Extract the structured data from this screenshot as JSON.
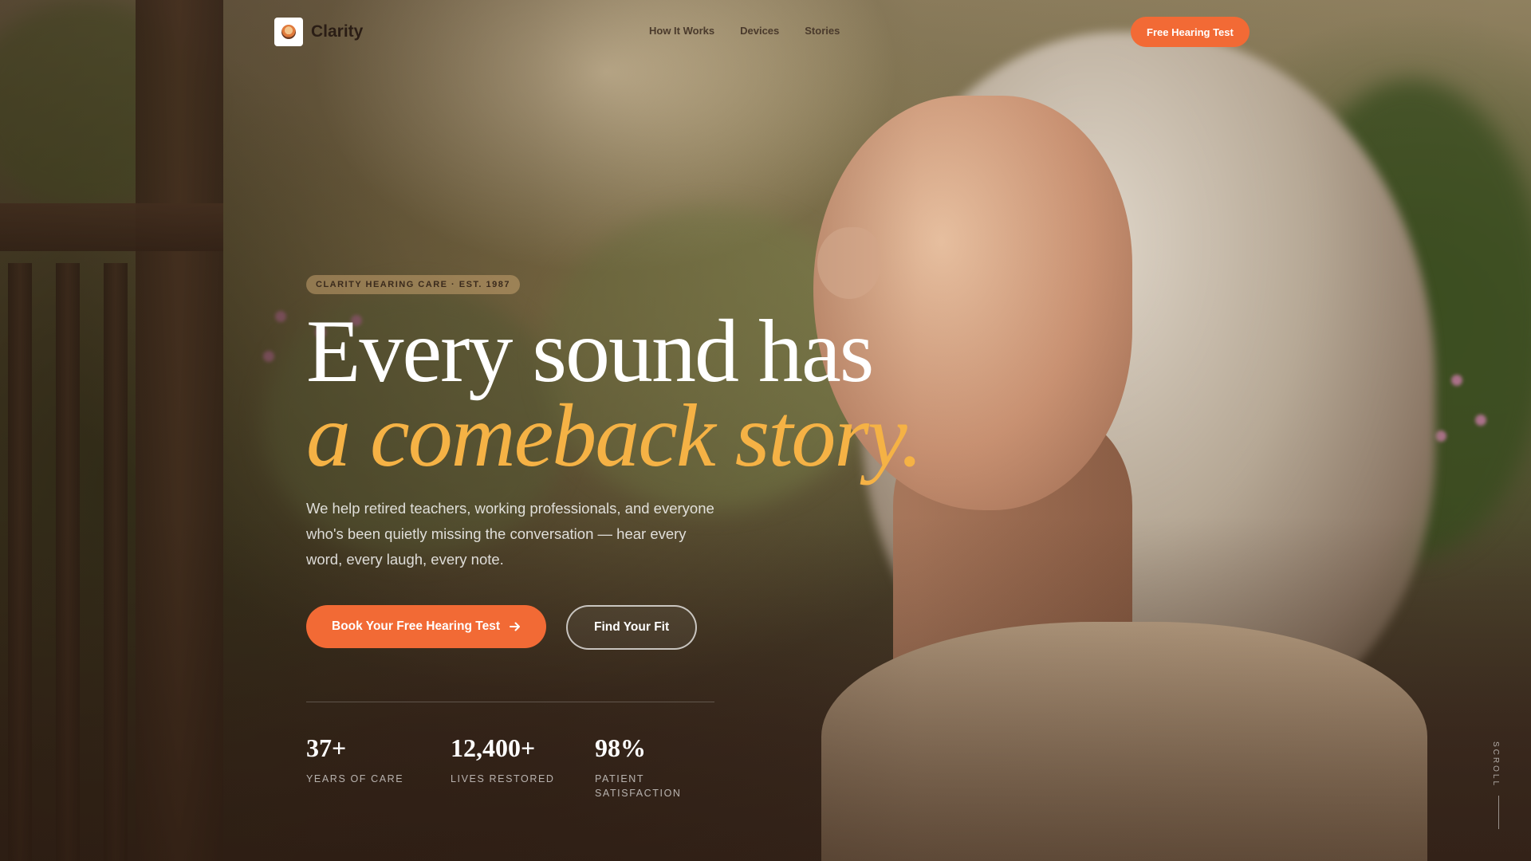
{
  "nav": {
    "brand": "Clarity",
    "links": [
      "How It Works",
      "Devices",
      "Stories"
    ],
    "cta": "Free Hearing Test"
  },
  "hero": {
    "eyebrow": "CLARITY HEARING CARE · EST. 1987",
    "headline_line1": "Every sound has",
    "headline_line2": "a comeback story.",
    "subcopy": "We help retired teachers, working professionals, and everyone who's been quietly missing the conversation — hear every word, every laugh, every note.",
    "primary_cta": "Book Your Free Hearing Test",
    "secondary_cta": "Find Your Fit"
  },
  "stats": [
    {
      "value": "37+",
      "label": "YEARS OF CARE"
    },
    {
      "value": "12,400+",
      "label": "LIVES RESTORED"
    },
    {
      "value": "98%",
      "label": "PATIENT SATISFACTION"
    }
  ],
  "scroll_label": "SCROLL",
  "colors": {
    "accent": "#f26a35",
    "headline_highlight": "#f5b245"
  },
  "icons": {
    "cta_arrow": "arrow-right-icon",
    "logo": "ear-logo-icon"
  }
}
